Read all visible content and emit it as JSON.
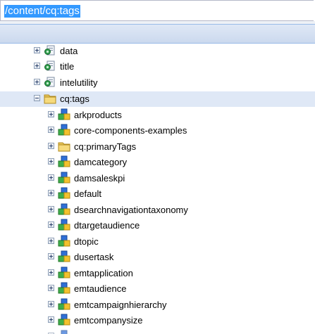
{
  "path_bar": {
    "value": "/content/cq:tags"
  },
  "tree": {
    "top_nodes": [
      {
        "label": "data",
        "icon": "node-file-icon"
      },
      {
        "label": "title",
        "icon": "node-file-icon"
      },
      {
        "label": "intelutility",
        "icon": "node-file-icon"
      }
    ],
    "open_node": {
      "label": "cq:tags",
      "icon": "folder-icon"
    },
    "child_nodes": [
      {
        "label": "arkproducts",
        "icon": "shapes-node-icon"
      },
      {
        "label": "core-components-examples",
        "icon": "shapes-node-icon"
      },
      {
        "label": "cq:primaryTags",
        "icon": "folder-icon"
      },
      {
        "label": "damcategory",
        "icon": "shapes-node-icon"
      },
      {
        "label": "damsaleskpi",
        "icon": "shapes-node-icon"
      },
      {
        "label": "default",
        "icon": "shapes-node-icon"
      },
      {
        "label": "dsearchnavigationtaxonomy",
        "icon": "shapes-node-icon"
      },
      {
        "label": "dtargetaudience",
        "icon": "shapes-node-icon"
      },
      {
        "label": "dtopic",
        "icon": "shapes-node-icon"
      },
      {
        "label": "dusertask",
        "icon": "shapes-node-icon"
      },
      {
        "label": "emtapplication",
        "icon": "shapes-node-icon"
      },
      {
        "label": "emtaudience",
        "icon": "shapes-node-icon"
      },
      {
        "label": "emtcampaignhierarchy",
        "icon": "shapes-node-icon"
      },
      {
        "label": "emtcompanysize",
        "icon": "shapes-node-icon"
      }
    ]
  },
  "colors": {
    "selection_highlight": "#3399ff",
    "selected_row": "#dfe8f6",
    "header_band": "#cbd9ee"
  }
}
